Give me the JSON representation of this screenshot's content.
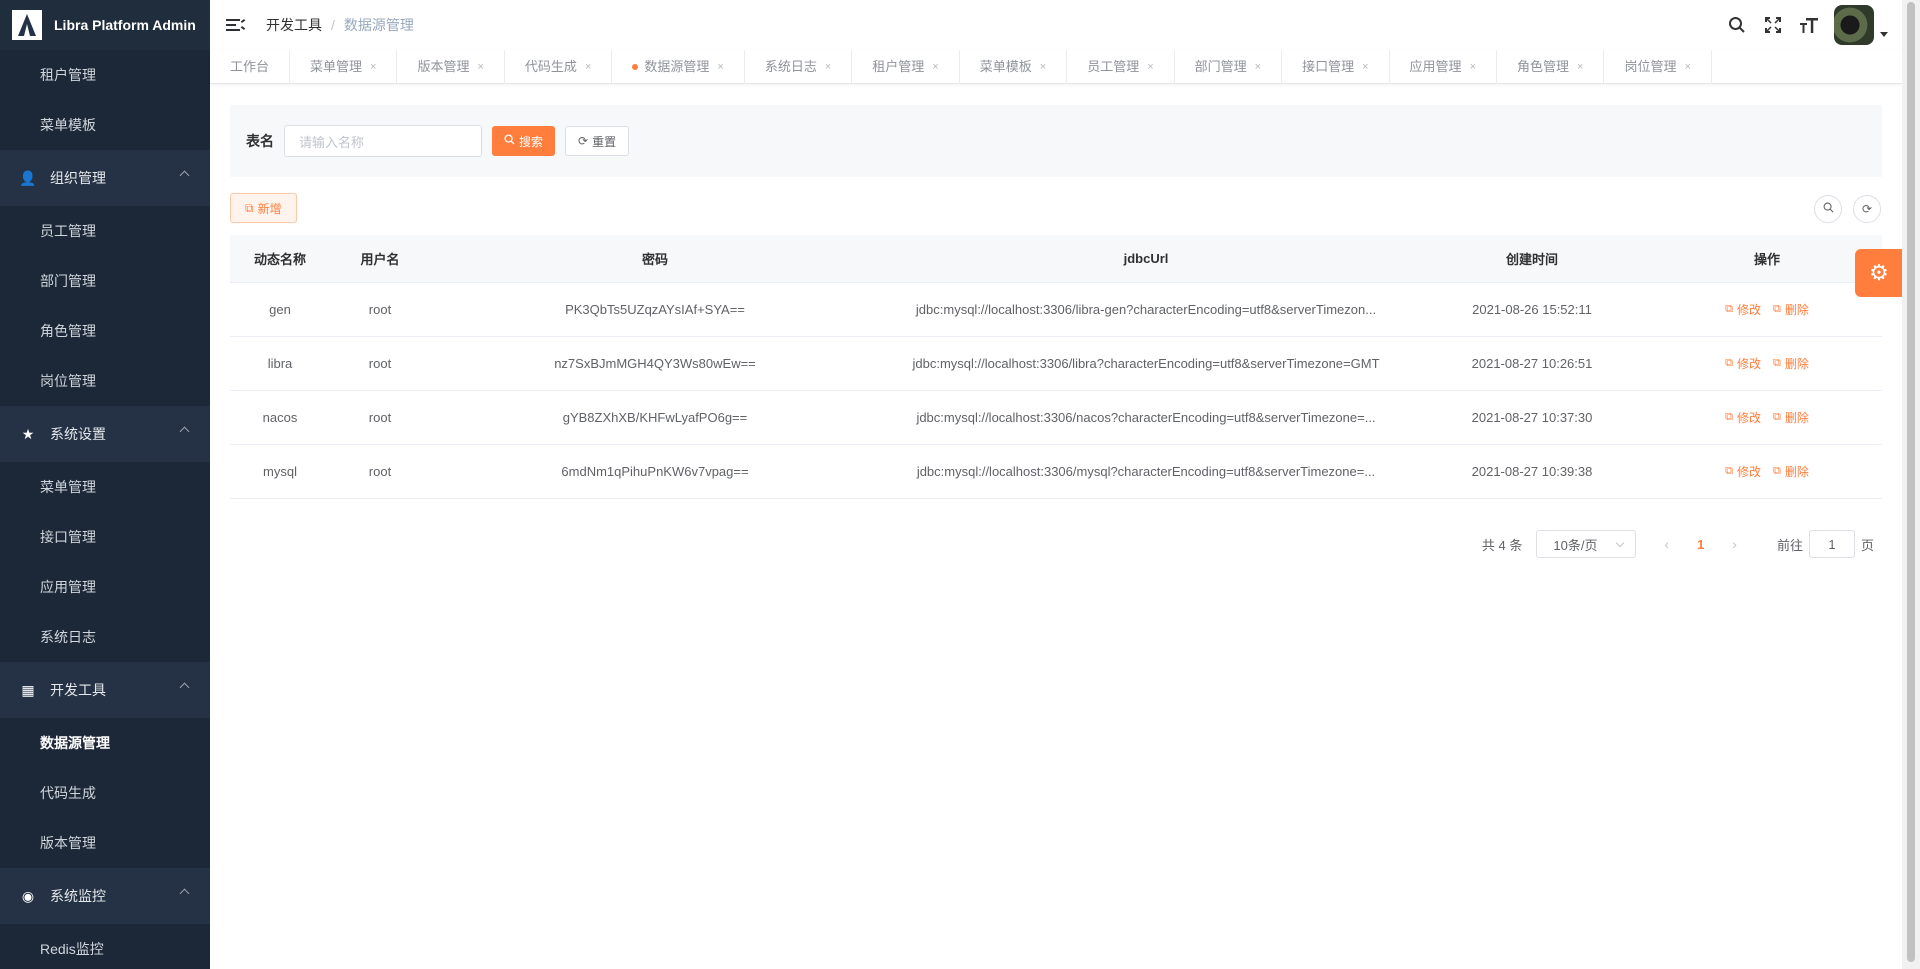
{
  "app": {
    "title": "Libra Platform Admin"
  },
  "sidebar": {
    "items": [
      {
        "type": "sub",
        "label": "租户管理"
      },
      {
        "type": "sub",
        "label": "菜单模板"
      },
      {
        "type": "group",
        "label": "组织管理",
        "icon": "user-icon"
      },
      {
        "type": "sub",
        "label": "员工管理"
      },
      {
        "type": "sub",
        "label": "部门管理"
      },
      {
        "type": "sub",
        "label": "角色管理"
      },
      {
        "type": "sub",
        "label": "岗位管理"
      },
      {
        "type": "group",
        "label": "系统设置",
        "icon": "star-icon"
      },
      {
        "type": "sub",
        "label": "菜单管理"
      },
      {
        "type": "sub",
        "label": "接口管理"
      },
      {
        "type": "sub",
        "label": "应用管理"
      },
      {
        "type": "sub",
        "label": "系统日志"
      },
      {
        "type": "group",
        "label": "开发工具",
        "icon": "grid-icon"
      },
      {
        "type": "sub",
        "label": "数据源管理",
        "active": true
      },
      {
        "type": "sub",
        "label": "代码生成"
      },
      {
        "type": "sub",
        "label": "版本管理"
      },
      {
        "type": "group",
        "label": "系统监控",
        "icon": "monitor-icon"
      },
      {
        "type": "sub",
        "label": "Redis监控"
      }
    ]
  },
  "header": {
    "breadcrumb": [
      "开发工具",
      "数据源管理"
    ],
    "breadcrumb_sep": "/"
  },
  "tags": [
    {
      "label": "工作台",
      "closable": false
    },
    {
      "label": "菜单管理",
      "closable": true
    },
    {
      "label": "版本管理",
      "closable": true
    },
    {
      "label": "代码生成",
      "closable": true
    },
    {
      "label": "数据源管理",
      "closable": true,
      "active": true
    },
    {
      "label": "系统日志",
      "closable": true
    },
    {
      "label": "租户管理",
      "closable": true
    },
    {
      "label": "菜单模板",
      "closable": true
    },
    {
      "label": "员工管理",
      "closable": true
    },
    {
      "label": "部门管理",
      "closable": true
    },
    {
      "label": "接口管理",
      "closable": true
    },
    {
      "label": "应用管理",
      "closable": true
    },
    {
      "label": "角色管理",
      "closable": true
    },
    {
      "label": "岗位管理",
      "closable": true
    }
  ],
  "search": {
    "label": "表名",
    "placeholder": "请输入名称",
    "search_label": "搜索",
    "reset_label": "重置"
  },
  "toolbar": {
    "add_label": "新增"
  },
  "table": {
    "columns": [
      "动态名称",
      "用户名",
      "密码",
      "jdbcUrl",
      "创建时间",
      "操作"
    ],
    "rows": [
      {
        "name": "gen",
        "user": "root",
        "password": "PK3QbTs5UZqzAYsIAf+SYA==",
        "url": "jdbc:mysql://localhost:3306/libra-gen?characterEncoding=utf8&serverTimezon...",
        "created": "2021-08-26 15:52:11"
      },
      {
        "name": "libra",
        "user": "root",
        "password": "nz7SxBJmMGH4QY3Ws80wEw==",
        "url": "jdbc:mysql://localhost:3306/libra?characterEncoding=utf8&serverTimezone=GMT",
        "created": "2021-08-27 10:26:51"
      },
      {
        "name": "nacos",
        "user": "root",
        "password": "gYB8ZXhXB/KHFwLyafPO6g==",
        "url": "jdbc:mysql://localhost:3306/nacos?characterEncoding=utf8&serverTimezone=...",
        "created": "2021-08-27 10:37:30"
      },
      {
        "name": "mysql",
        "user": "root",
        "password": "6mdNm1qPihuPnKW6v7vpag==",
        "url": "jdbc:mysql://localhost:3306/mysql?characterEncoding=utf8&serverTimezone=...",
        "created": "2021-08-27 10:39:38"
      }
    ],
    "edit_label": "修改",
    "delete_label": "删除"
  },
  "pagination": {
    "total_text": "共 4 条",
    "page_size": "10条/页",
    "current_page": "1",
    "goto_prefix": "前往",
    "goto_value": "1",
    "goto_suffix": "页"
  },
  "colors": {
    "accent": "#ff7d3d",
    "sidebar_bg": "#253245"
  }
}
